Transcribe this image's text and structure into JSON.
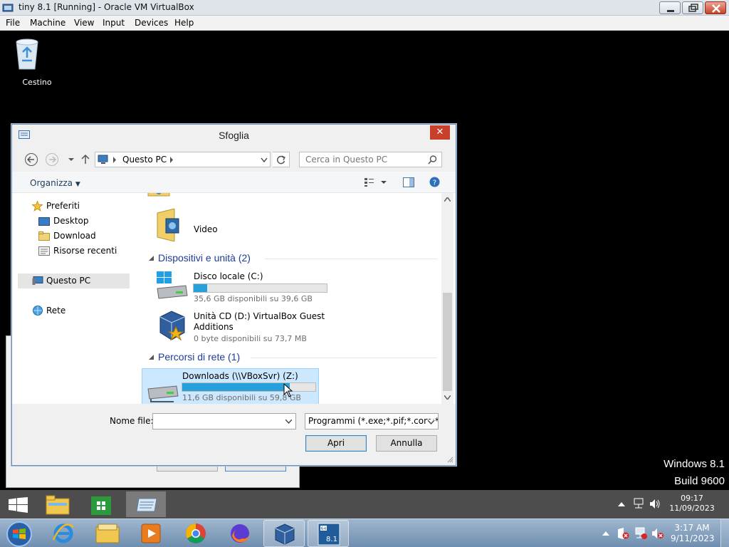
{
  "host_window": {
    "title": "tiny 8.1 [Running] - Oracle VM VirtualBox",
    "menu": [
      "File",
      "Machine",
      "View",
      "Input",
      "Devices",
      "Help"
    ]
  },
  "desktop": {
    "recycle_bin_label": "Cestino",
    "watermark_line1": "Windows 8.1",
    "watermark_line2": "Build 9600"
  },
  "dialog": {
    "title": "Sfoglia",
    "breadcrumb": "Questo PC",
    "search_placeholder": "Cerca in Questo PC",
    "organize_label": "Organizza",
    "nav": {
      "favorites": "Preferiti",
      "desktop": "Desktop",
      "downloads": "Download",
      "recent": "Risorse recenti",
      "this_pc": "Questo PC",
      "network": "Rete"
    },
    "content": {
      "video_label": "Video",
      "devices_group": "Dispositivi e unità (2)",
      "network_group": "Percorsi di rete (1)",
      "drives": [
        {
          "name": "Disco locale (C:)",
          "free": "35,6 GB disponibili su 39,6 GB",
          "used_fraction": 0.1
        },
        {
          "name_line1": "Unità CD (D:) VirtualBox Guest",
          "name_line2": "Additions",
          "free": "0 byte disponibili su 73,7 MB"
        },
        {
          "name": "Downloads (\\\\VBoxSvr) (Z:)",
          "free": "11,6 GB disponibili su 59,8 GB",
          "used_fraction": 0.81
        }
      ]
    },
    "filename_label": "Nome file:",
    "filename_value": "",
    "filetype_value": "Programmi (*.exe;*.pif;*.com;*.",
    "open_button": "Apri",
    "cancel_button": "Annulla"
  },
  "guest_taskbar": {
    "time": "09:17",
    "date": "11/09/2023"
  },
  "host_taskbar": {
    "time": "3:17 AM",
    "date": "9/11/2023"
  },
  "colors": {
    "accent": "#26a0da",
    "selection": "#cce8ff",
    "group_header": "#1e3c96",
    "dialog_close": "#c7402b"
  }
}
